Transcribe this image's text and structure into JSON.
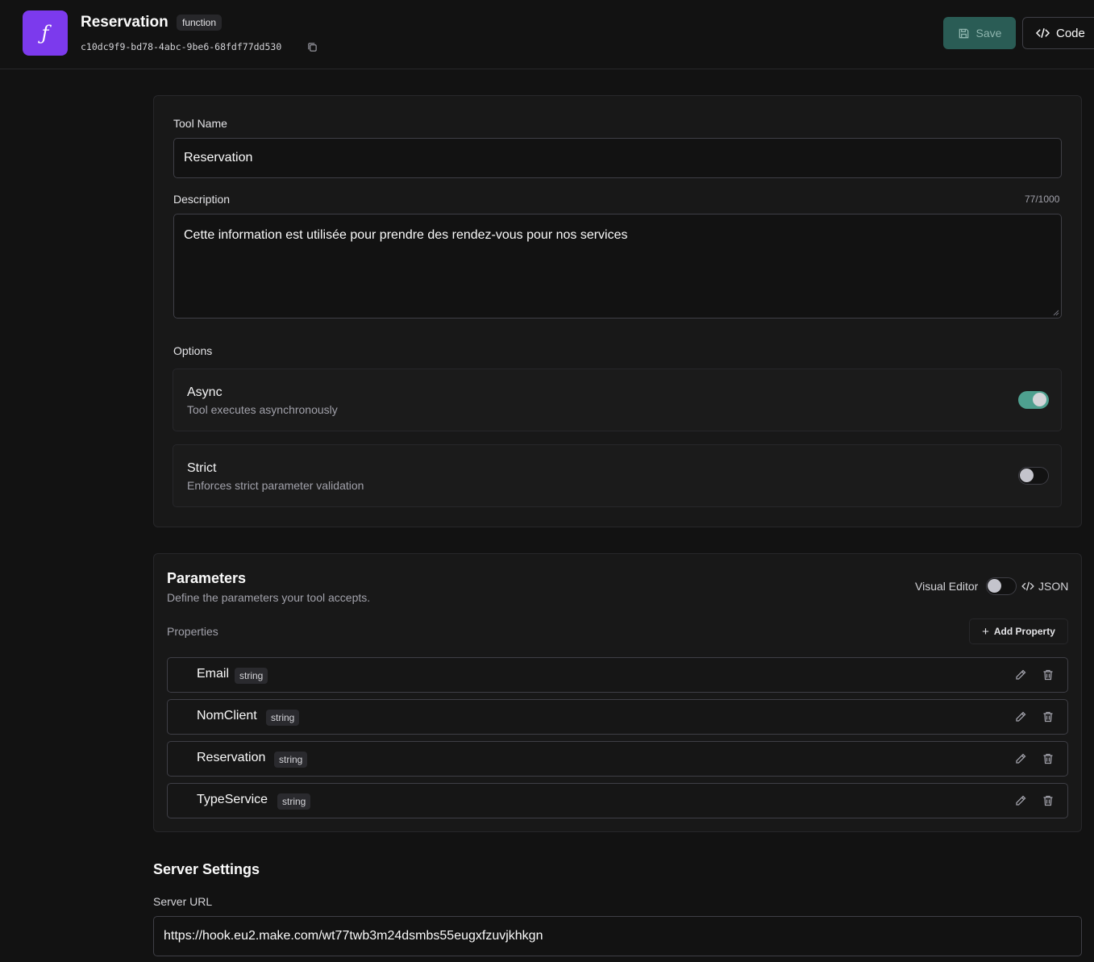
{
  "header": {
    "icon_glyph": "ƒ",
    "title": "Reservation",
    "badge": "function",
    "id": "c10dc9f9-bd78-4abc-9be6-68fdf77dd530",
    "save_label": "Save",
    "code_label": "Code"
  },
  "form": {
    "tool_name_label": "Tool Name",
    "tool_name_value": "Reservation",
    "description_label": "Description",
    "description_counter": "77/1000",
    "description_value": "Cette information est utilisée pour prendre des rendez-vous pour nos services",
    "options_label": "Options",
    "options": [
      {
        "title": "Async",
        "desc": "Tool executes asynchronously",
        "enabled": true
      },
      {
        "title": "Strict",
        "desc": "Enforces strict parameter validation",
        "enabled": false
      }
    ]
  },
  "parameters": {
    "title": "Parameters",
    "subtitle": "Define the parameters your tool accepts.",
    "visual_editor_label": "Visual Editor",
    "visual_editor_enabled": false,
    "json_label": "JSON",
    "properties_label": "Properties",
    "add_property_label": "Add Property",
    "properties": [
      {
        "name": "Email",
        "type": "string"
      },
      {
        "name": "NomClient",
        "type": "string"
      },
      {
        "name": "Reservation",
        "type": "string"
      },
      {
        "name": "TypeService",
        "type": "string"
      }
    ]
  },
  "server": {
    "title": "Server Settings",
    "url_label": "Server URL",
    "url_value": "https://hook.eu2.make.com/wt77twb3m24dsmbs55eugxfzuvjkhkgn"
  },
  "colors": {
    "accent_purple": "#7c3aed",
    "toggle_on": "#4ea08f",
    "save_button_bg": "#2a5c55",
    "background": "#121212"
  }
}
